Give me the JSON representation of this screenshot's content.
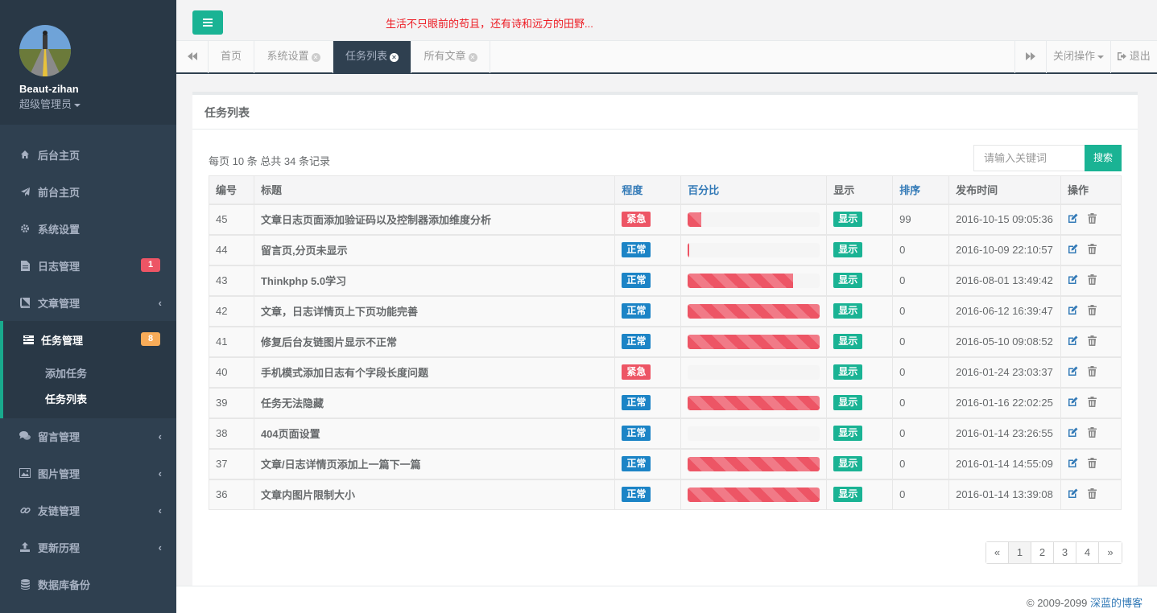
{
  "profile": {
    "name": "Beaut-zihan",
    "role": "超级管理员"
  },
  "nav": [
    {
      "label": "后台主页",
      "icon": "home-icon"
    },
    {
      "label": "前台主页",
      "icon": "paper-plane-icon"
    },
    {
      "label": "系统设置",
      "icon": "gear-icon"
    },
    {
      "label": "日志管理",
      "icon": "file-icon",
      "badge": "1"
    },
    {
      "label": "文章管理",
      "icon": "book-icon"
    },
    {
      "label": "任务管理",
      "icon": "tasks-icon",
      "badge": "8"
    },
    {
      "label": "留言管理",
      "icon": "comments-icon"
    },
    {
      "label": "图片管理",
      "icon": "picture-icon"
    },
    {
      "label": "友链管理",
      "icon": "link-icon"
    },
    {
      "label": "更新历程",
      "icon": "upload-icon"
    },
    {
      "label": "数据库备份",
      "icon": "database-icon"
    }
  ],
  "subnav": [
    {
      "label": "添加任务"
    },
    {
      "label": "任务列表"
    }
  ],
  "topbar": {
    "motto": "生活不只眼前的苟且，还有诗和远方的田野..."
  },
  "tabs": [
    {
      "label": "首页"
    },
    {
      "label": "系统设置"
    },
    {
      "label": "任务列表"
    },
    {
      "label": "所有文章"
    }
  ],
  "tabs_right": {
    "close_ops": "关闭操作",
    "logout": "退出"
  },
  "panel": {
    "title": "任务列表",
    "record_info": "每页 10 条 总共 34 条记录",
    "search_placeholder": "请输入关键词",
    "search_button": "搜索"
  },
  "table": {
    "headers": [
      "编号",
      "标题",
      "程度",
      "百分比",
      "显示",
      "排序",
      "发布时间",
      "操作"
    ],
    "rows": [
      {
        "id": "45",
        "title": "文章日志页面添加验证码以及控制器添加维度分析",
        "level": "紧急",
        "percent": 10,
        "show": "显示",
        "sort": "99",
        "time": "2016-10-15 09:05:36"
      },
      {
        "id": "44",
        "title": "留言页,分页未显示",
        "level": "正常",
        "percent": 1,
        "show": "显示",
        "sort": "0",
        "time": "2016-10-09 22:10:57"
      },
      {
        "id": "43",
        "title": "Thinkphp 5.0学习",
        "level": "正常",
        "percent": 80,
        "show": "显示",
        "sort": "0",
        "time": "2016-08-01 13:49:42"
      },
      {
        "id": "42",
        "title": "文章，日志详情页上下页功能完善",
        "level": "正常",
        "percent": 100,
        "show": "显示",
        "sort": "0",
        "time": "2016-06-12 16:39:47"
      },
      {
        "id": "41",
        "title": "修复后台友链图片显示不正常",
        "level": "正常",
        "percent": 100,
        "show": "显示",
        "sort": "0",
        "time": "2016-05-10 09:08:52"
      },
      {
        "id": "40",
        "title": "手机模式添加日志有个字段长度问题",
        "level": "紧急",
        "percent": 0,
        "show": "显示",
        "sort": "0",
        "time": "2016-01-24 23:03:37"
      },
      {
        "id": "39",
        "title": "任务无法隐藏",
        "level": "正常",
        "percent": 100,
        "show": "显示",
        "sort": "0",
        "time": "2016-01-16 22:02:25"
      },
      {
        "id": "38",
        "title": "404页面设置",
        "level": "正常",
        "percent": 0,
        "show": "显示",
        "sort": "0",
        "time": "2016-01-14 23:26:55"
      },
      {
        "id": "37",
        "title": "文章/日志详情页添加上一篇下一篇",
        "level": "正常",
        "percent": 100,
        "show": "显示",
        "sort": "0",
        "time": "2016-01-14 14:55:09"
      },
      {
        "id": "36",
        "title": "文章内图片限制大小",
        "level": "正常",
        "percent": 100,
        "show": "显示",
        "sort": "0",
        "time": "2016-01-14 13:39:08"
      }
    ]
  },
  "pagination": [
    "«",
    "1",
    "2",
    "3",
    "4",
    "»"
  ],
  "footer": {
    "copyright": "© 2009-2099 ",
    "site": "深蓝的博客"
  },
  "colors": {
    "accent": "#1ab394",
    "danger": "#ed5565",
    "primary": "#1c84c6",
    "sidebar": "#2f4050",
    "badge_warning": "#f8ac59"
  }
}
